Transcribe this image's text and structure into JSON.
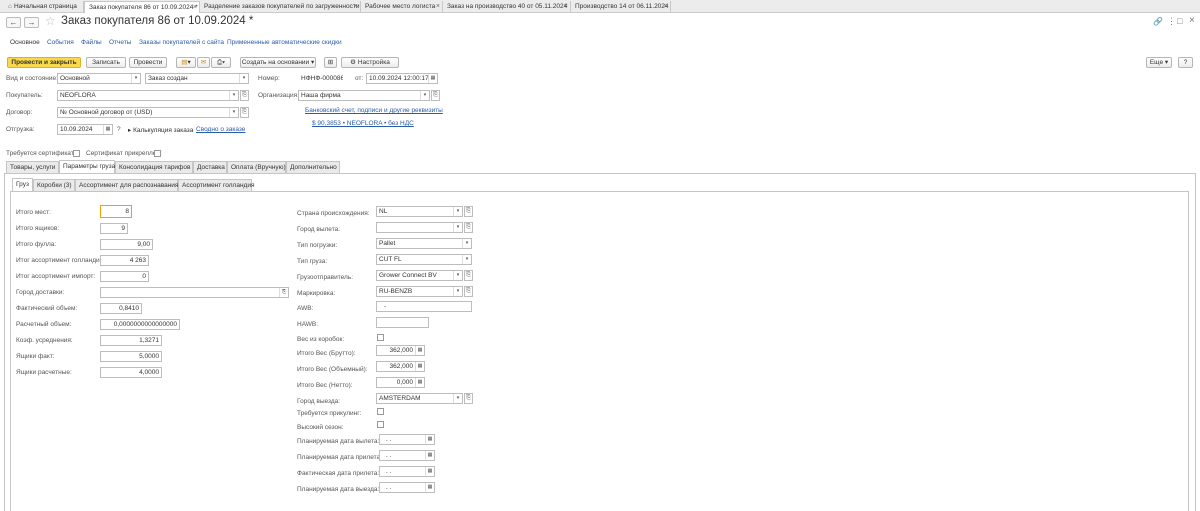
{
  "window_tabs": [
    {
      "label": "Начальная страница",
      "closable": false
    },
    {
      "label": "Заказ покупателя 86 от 10.09.2024 *",
      "closable": true,
      "active": true
    },
    {
      "label": "Разделение заказов покупателей по загруженности",
      "closable": true
    },
    {
      "label": "Рабочее место логиста",
      "closable": true
    },
    {
      "label": "Заказ на производство 40 от 05.11.2024",
      "closable": true
    },
    {
      "label": "Производство 14 от 06.11.2024",
      "closable": true
    }
  ],
  "title": "Заказ покупателя 86 от 10.09.2024 *",
  "sections": [
    "Основное",
    "События",
    "Файлы",
    "Отчеты",
    "Заказы покупателей с сайта",
    "Примененные автоматические скидки"
  ],
  "toolbar": {
    "post_close": "Провести и закрыть",
    "save": "Записать",
    "post": "Провести",
    "create_based": "Создать на основании",
    "settings": "Настройка",
    "more": "Еще",
    "help": "?"
  },
  "header": {
    "kind_state_label": "Вид и состояние:",
    "kind_value": "Основной",
    "state_value": "Заказ создан",
    "number_label": "Номер:",
    "number_value": "НФНФ-000086",
    "date_label": "от:",
    "date_value": "10.09.2024 12:00:17",
    "buyer_label": "Покупатель:",
    "buyer_value": "NEOFLORA",
    "org_label": "Организация:",
    "org_value": "Наша фирма",
    "contract_label": "Договор:",
    "contract_value": "№ Основной договор от (USD)",
    "bank_link": "Банковский счет, подписи и другие реквизиты",
    "shipment_label": "Отгрузка:",
    "shipment_date": "10.09.2024",
    "calc_label": "Калькуляция заказа",
    "order_link": "Сводно о заказе",
    "sum_link": "$ 90,3853 • NEOFLORA • без НДС",
    "cert_required_label": "Требуется сертификат:",
    "cert_attached_label": "Сертификат прикреплен:"
  },
  "main_tabs": [
    "Товары, услуги",
    "Параметры груза",
    "Консолидация тарифов",
    "Доставка",
    "Оплата (Вручную)",
    "Дополнительно"
  ],
  "sub_tabs": [
    "Груз",
    "Коробки (3)",
    "Ассортимент для распознавания",
    "Ассортимент голландия"
  ],
  "cargo_left": [
    {
      "label": "Итого мест:",
      "value": "8"
    },
    {
      "label": "Итого ящиков:",
      "value": "9"
    },
    {
      "label": "Итого фулла:",
      "value": "9,00"
    },
    {
      "label": "Итог ассортимент голландия:",
      "value": "4 263"
    },
    {
      "label": "Итог ассортимент импорт:",
      "value": "0"
    },
    {
      "label": "Город доставки:",
      "value": ""
    },
    {
      "label": "Фактический объем:",
      "value": "0,8410"
    },
    {
      "label": "Расчетный объем:",
      "value": "0,0000000000000000"
    },
    {
      "label": "Коэф. усреднения:",
      "value": "1,3271"
    },
    {
      "label": "Ящики факт:",
      "value": "5,0000"
    },
    {
      "label": "Ящики расчетные:",
      "value": "4,0000"
    }
  ],
  "cargo_right": [
    {
      "label": "Страна происхождения:",
      "value": "NL"
    },
    {
      "label": "Город вылета:",
      "value": ""
    },
    {
      "label": "Тип погрузки:",
      "value": "Pallet"
    },
    {
      "label": "Тип груза:",
      "value": "CUT FL"
    },
    {
      "label": "Грузоотправитель:",
      "value": "Grower Connect BV"
    },
    {
      "label": "Маркировка:",
      "value": "RU-BENZB"
    },
    {
      "label": "AWB:",
      "value": "-"
    },
    {
      "label": "HAWB:",
      "value": ""
    },
    {
      "label": "Вес из коробок:",
      "value": ""
    },
    {
      "label": "Итого Вес (Брутто):",
      "value": "362,000"
    },
    {
      "label": "Итого Вес (Объемный):",
      "value": "362,000"
    },
    {
      "label": "Итого Вес (Нетто):",
      "value": "0,000"
    },
    {
      "label": "Город выезда:",
      "value": "AMSTERDAM"
    },
    {
      "label": "Требуется прикулинг:",
      "value": ""
    },
    {
      "label": "Высокий сезон:",
      "value": ""
    },
    {
      "label": "Планируемая дата вылета:",
      "value": ". ."
    },
    {
      "label": "Планируемая дата прилета:",
      "value": ". ."
    },
    {
      "label": "Фактическая дата прилета:",
      "value": ". ."
    },
    {
      "label": "Планируемая дата выезда:",
      "value": ". ."
    }
  ],
  "colors": {
    "accent": "#f9d94b",
    "link": "#2a5caa"
  }
}
